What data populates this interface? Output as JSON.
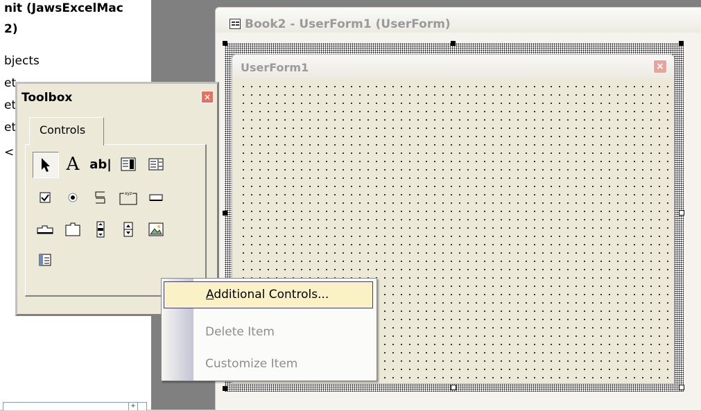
{
  "project_pane": {
    "line1": "nit (JawsExcelMac",
    "line2": "2)",
    "line3": "bjects",
    "line4": "et",
    "line5": "et",
    "line6": "et",
    "line7": "<",
    "scroll_button": "+"
  },
  "designer": {
    "title": "Book2 - UserForm1 (UserForm)"
  },
  "userform": {
    "title": "UserForm1",
    "close_glyph": "×"
  },
  "toolbox": {
    "title": "Toolbox",
    "close_glyph": "×",
    "tab_label": "Controls",
    "tools": [
      "select-objects",
      "label",
      "textbox",
      "combobox",
      "listbox",
      "checkbox",
      "optionbutton",
      "togglebutton",
      "frame",
      "commandbutton",
      "tabstrip",
      "multipage",
      "scrollbar",
      "spinbutton",
      "image",
      "refedit"
    ]
  },
  "context_menu": {
    "add_prefix": "A",
    "add_rest": "dditional Controls...",
    "delete_item": "Delete Item",
    "customize_item": "Customize Item"
  },
  "colors": {
    "workspace": "#808080",
    "menu_highlight": "#fbf1c7",
    "menu_highlight_border": "#3d3a70",
    "close_red": "#e87060"
  }
}
